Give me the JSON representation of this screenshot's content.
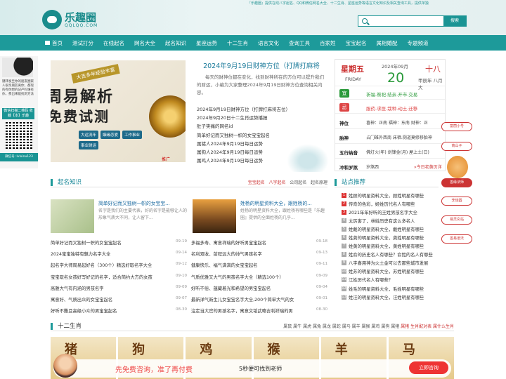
{
  "header": {
    "logo_text": "乐趣圈",
    "logo_sub": "QQLQQ.COM",
    "notice": "『乐趣圈』提供在线八字起名、QQ和微信网名大全、十二生肖、星座运势等语言文化知识及相关查询工具，提供单独",
    "search": {
      "placeholder": "",
      "button": "搜索"
    }
  },
  "nav": {
    "items": [
      "首页",
      "测试打分",
      "在线起名",
      "网名大全",
      "起名知识",
      "星座运势",
      "十二生肖",
      "语言文化",
      "查询工具",
      "百家姓",
      "宝宝起名",
      "属相婚配",
      "专题频道"
    ]
  },
  "sidebar": {
    "text": "键转发至你的朋友圈家人很亲朋友离你，都现的有你想的记产吗谁有你，费出来能找到方法",
    "button": "微信扫描二维码\n收藏【本】乐趣",
    "footer": "微信号: lvlxinu123"
  },
  "banner": {
    "tag": "大吉多年经验丰富",
    "headline1": "周易解析",
    "headline2": "免费试测",
    "pills": [
      "大运流年",
      "姻缘恋爱",
      "工作事业",
      "事业财运"
    ],
    "ad_label": "推广"
  },
  "feature": {
    "title": "2024年9月19日财神方位（打牌打麻将",
    "desc": "每天的财神位都在变化，找到财神所在的方位可以提升我们的财运，小编为大家整理2024年9月19日财神方位查询相关内容。",
    "links": [
      "2024年9月19日财神方位（打牌打麻将吉位）",
      "2024年9月20日十二生肖运势播报",
      "肚子笑痛的网名id",
      "简单好记而又独树一帜的女宝宝起名",
      "属猪人2024年9月19日每日运势",
      "属狗人2024年9月19日每日运势",
      "属鸡人2024年9月19日每日运势"
    ]
  },
  "calendar": {
    "weekday": "星期五",
    "weekday_en": "FRIDAY",
    "date": "2024年09月",
    "day": "20",
    "lunar_day": "十八",
    "lunar_info": "甲辰年 八月大",
    "yi_label": "宜",
    "yi": "祈福.祭祀.结亲.开市.交易",
    "ji_label": "忌",
    "ji": "服药.求医.栽种.动土.迁移",
    "rows": [
      {
        "label": "神位",
        "value": "喜神：正南 福神：东南 财神：正"
      },
      {
        "label": "胎神",
        "value": "占门碓外西南 床栖.厕道莫修移胎神"
      },
      {
        "label": "五行纳音",
        "value": "佛灯火(年) 剑锋金(月) 屋上土(日)"
      },
      {
        "label": "冲和岁煞",
        "value": "岁煞西",
        "extra": "»今日老黄历详"
      }
    ]
  },
  "float_right": [
    "富丽小号",
    "南山子",
    "善缘法师",
    "李佳圆",
    "易灵玄站",
    "善易道法"
  ],
  "naming": {
    "title": "起名知识",
    "links": [
      "宝宝起名",
      "八字起名",
      "公司起名",
      "起名原理"
    ],
    "articles": [
      {
        "title": "简单好记而又独树一帜的女宝宝...",
        "desc": "名字是我们的主要代表，好的名字是能够让人的形象气质大不同，让人留下..."
      },
      {
        "title": "姓杨的明星资料大全，跟姓杨的...",
        "desc": "姓杨的明星资料大全，跟姓杨有哪些是『乐趣圈』提供的全面姓杨的几乎..."
      }
    ],
    "left_list": [
      {
        "text": "简单好记而又独树一帜的女宝宝起名",
        "date": "09-19"
      },
      {
        "text": "2024宝宝独特有魅力名字大全",
        "date": "09-14"
      },
      {
        "text": "起名字大师周易起好名（300个）精选好取名字大全",
        "date": "09-12"
      },
      {
        "text": "宝宝取名女孩好写好记的名字，适合简约大方的女孩",
        "date": "09-10"
      },
      {
        "text": "高雅大气有内涵的男孩名字",
        "date": "09-09"
      },
      {
        "text": "寓意好、气质出众的女宝宝起名",
        "date": "09-07"
      },
      {
        "text": "好听不難且高级小众的男宝宝起名",
        "date": "08-30"
      }
    ],
    "right_list": [
      {
        "text": "多福多寿、寓意祥瑞的好听男宝宝起名",
        "date": "09-18"
      },
      {
        "text": "名利双收、前程远大的帅气男孩名字",
        "date": "09-13"
      },
      {
        "text": "健康快乐、福气满满的女宝宝起名",
        "date": "09-11"
      },
      {
        "text": "气质优雅又大气的男孩名字大全（精选100个）",
        "date": "09-09"
      },
      {
        "text": "好听不俗、蕴藏着光和希望的男宝宝起名",
        "date": "09-04"
      },
      {
        "text": "最新洋气新生儿女宝宝名字大全,200个简单大气的女",
        "date": "09-01"
      },
      {
        "text": "注定当大官的男孩名字，寓意文韬武略吉利祥瑞的男",
        "date": "08-30"
      }
    ]
  },
  "hot": {
    "title": "站点推荐",
    "items": [
      "姓顾的明星资料大全，顾姓明星有哪些",
      "传奇的色彩，姬姓历代名人有哪些",
      "2021年年好听的王姓男孩名字大全",
      "太厉害了，林姓历史有这么多名人",
      "姓戴的明星资料大全，戴姓明星有哪些",
      "姓龚的明星资料大全，龚姓明星有哪些",
      "姓黄的明星资料大全，黄姓明星有哪些",
      "姓俞的历史名人有哪些？俞姓的名人有哪些",
      "八字喜用神为火土金可以去那些城市发展",
      "姓苏的明星资料大全，苏姓明星有哪些",
      "江姓历代名人有哪些？",
      "姓毛的明星资料大全，毛姓明星有哪些",
      "姓汪的明星资料大全，汪姓明星有哪些"
    ]
  },
  "zodiac": {
    "title": "十二生肖",
    "links": "属鼠 属牛 属虎 属兔 属龙 属蛇 属马 属羊 属猴 属鸡 属狗 属猪",
    "extra": "属猪 生肖配对表 属什么生肖",
    "cards": [
      "猪",
      "狗",
      "鸡",
      "猴",
      "羊",
      "马"
    ]
  },
  "promo": {
    "text1": "先免费咨询，准了再付费",
    "text2": "5秒便可找到老师",
    "button": "立即咨询"
  },
  "colors": {
    "primary": "#1d9a9a",
    "accent": "#cc3333",
    "link": "#1a6aa0"
  }
}
